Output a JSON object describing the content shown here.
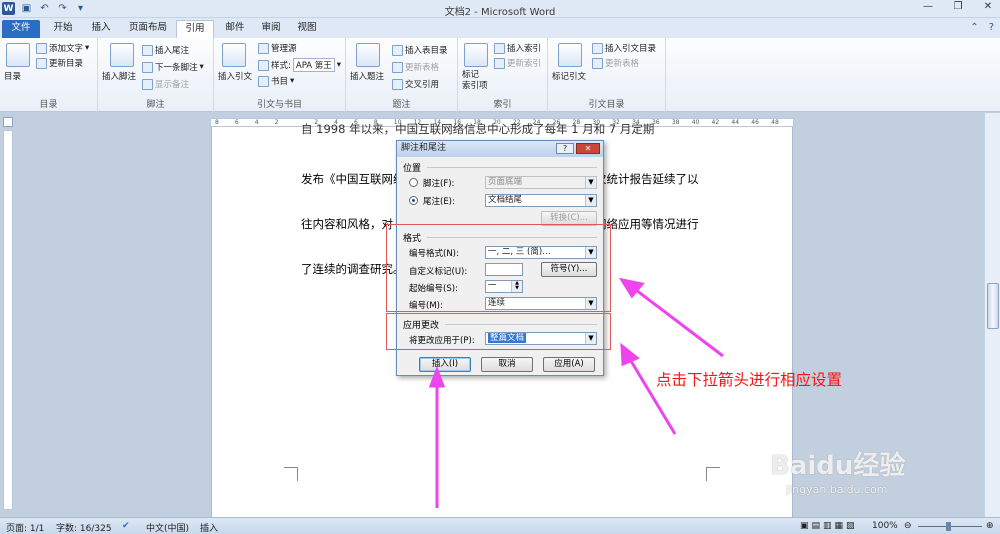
{
  "window": {
    "title": "文档2 - Microsoft Word"
  },
  "tabs": [
    "文件",
    "开始",
    "插入",
    "页面布局",
    "引用",
    "邮件",
    "审阅",
    "视图"
  ],
  "ribbon": {
    "toc": {
      "big": "目录",
      "add_text": "添加文字",
      "update": "更新目录",
      "group": "目录"
    },
    "footnote": {
      "big": "插入脚注",
      "insert_endnote": "插入尾注",
      "next": "下一条脚注",
      "show": "显示备注",
      "group": "脚注"
    },
    "citation": {
      "big": "插入引文",
      "manage": "管理源",
      "style_label": "样式:",
      "style_value": "APA 第王",
      "bib": "书目",
      "group": "引文与书目"
    },
    "caption": {
      "big": "插入题注",
      "insert_table": "插入表目录",
      "update": "更新表格",
      "cross": "交叉引用",
      "group": "题注"
    },
    "index": {
      "big": "标记\n索引项",
      "insert": "插入索引",
      "update": "更新索引",
      "group": "索引"
    },
    "toa": {
      "big": "标记引文",
      "insert": "插入引文目录",
      "update": "更新表格",
      "group": "引文目录"
    }
  },
  "ruler": {
    "ticks": [
      "8",
      "6",
      "4",
      "2",
      "",
      "2",
      "4",
      "6",
      "8",
      "10",
      "12",
      "14",
      "16",
      "18",
      "20",
      "22",
      "24",
      "26",
      "28",
      "30",
      "32",
      "34",
      "36",
      "38",
      "40",
      "42",
      "44",
      "46",
      "48"
    ]
  },
  "document": {
    "line0": "自 1998 年以来，中国互联网络信息中心形成了每年 1 月和 7 月定期",
    "line1a": "发布《中国互联网络",
    "line1b": "次统计报告延续了以",
    "line2a": "往内容和风格，对",
    "line2b": "网络应用等情况进行",
    "line3a": "了连续的调查研究。"
  },
  "dialog": {
    "title": "脚注和尾注",
    "help": "?",
    "close": "✕",
    "position_section": "位置",
    "footnote_label": "脚注(F):",
    "footnote_value": "页面底端",
    "endnote_label": "尾注(E):",
    "endnote_value": "文档结尾",
    "convert_button": "转换(C)...",
    "format_section": "格式",
    "number_format_label": "编号格式(N):",
    "number_format_value": "一, 二, 三 (简)…",
    "custom_mark_label": "自定义标记(U):",
    "custom_mark_value": "",
    "symbol_button": "符号(Y)...",
    "start_at_label": "起始编号(S):",
    "start_at_value": "一",
    "numbering_label": "编号(M):",
    "numbering_value": "连续",
    "apply_section": "应用更改",
    "apply_to_label": "将更改应用于(P):",
    "apply_to_value": "整篇文档",
    "insert_button": "插入(I)",
    "cancel_button": "取消",
    "apply_button": "应用(A)"
  },
  "annotation": "点击下拉箭头进行相应设置",
  "status": {
    "page": "页面: 1/1",
    "words": "字数: 16/325",
    "lang": "中文(中国)",
    "mode": "插入",
    "zoom": "100%"
  },
  "watermark": {
    "brand": "Baidu经验",
    "url": "jingyan.baidu.com"
  },
  "colors": {
    "accent": "#2b6cc4",
    "annotation": "#ff1111",
    "arrow": "#ee44ee"
  }
}
